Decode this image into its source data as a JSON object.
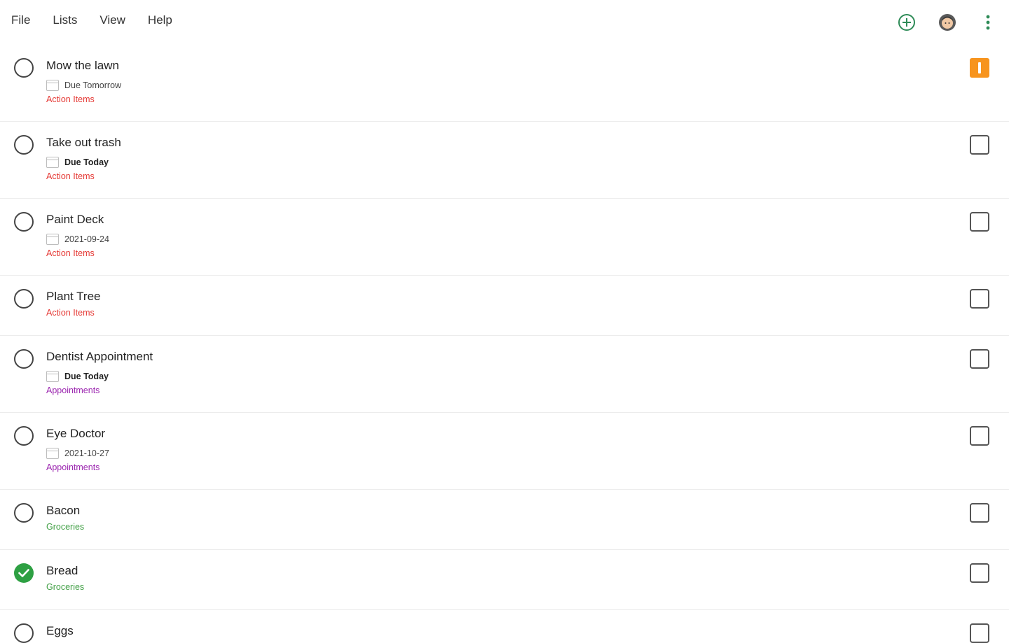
{
  "menu": {
    "items": [
      {
        "label": "File"
      },
      {
        "label": "Lists"
      },
      {
        "label": "View"
      },
      {
        "label": "Help"
      }
    ]
  },
  "toolbar": {
    "add_icon": "plus-circle-icon",
    "avatar_icon": "avatar-icon",
    "more_icon": "kebab-menu-icon"
  },
  "colors": {
    "accent_green": "#2e8b57",
    "priority_orange": "#f7941d",
    "action_items": "#e53935",
    "appointments": "#9c27b0",
    "groceries": "#43a047",
    "done_check": "#2ea043"
  },
  "tasks": [
    {
      "title": "Mow the lawn",
      "due": "Due Tomorrow",
      "category": "Action Items",
      "done": false,
      "priority": true
    },
    {
      "title": "Take out trash",
      "due": "Due Today",
      "category": "Action Items",
      "done": false,
      "priority": false
    },
    {
      "title": "Paint Deck",
      "due": "2021-09-24",
      "category": "Action Items",
      "done": false,
      "priority": false
    },
    {
      "title": "Plant Tree",
      "due": "",
      "category": "Action Items",
      "done": false,
      "priority": false
    },
    {
      "title": "Dentist Appointment",
      "due": "Due Today",
      "category": "Appointments",
      "done": false,
      "priority": false
    },
    {
      "title": "Eye Doctor",
      "due": "2021-10-27",
      "category": "Appointments",
      "done": false,
      "priority": false
    },
    {
      "title": "Bacon",
      "due": "",
      "category": "Groceries",
      "done": false,
      "priority": false
    },
    {
      "title": "Bread",
      "due": "",
      "category": "Groceries",
      "done": true,
      "priority": false
    },
    {
      "title": "Eggs",
      "due": "",
      "category": "",
      "done": false,
      "priority": false
    }
  ]
}
